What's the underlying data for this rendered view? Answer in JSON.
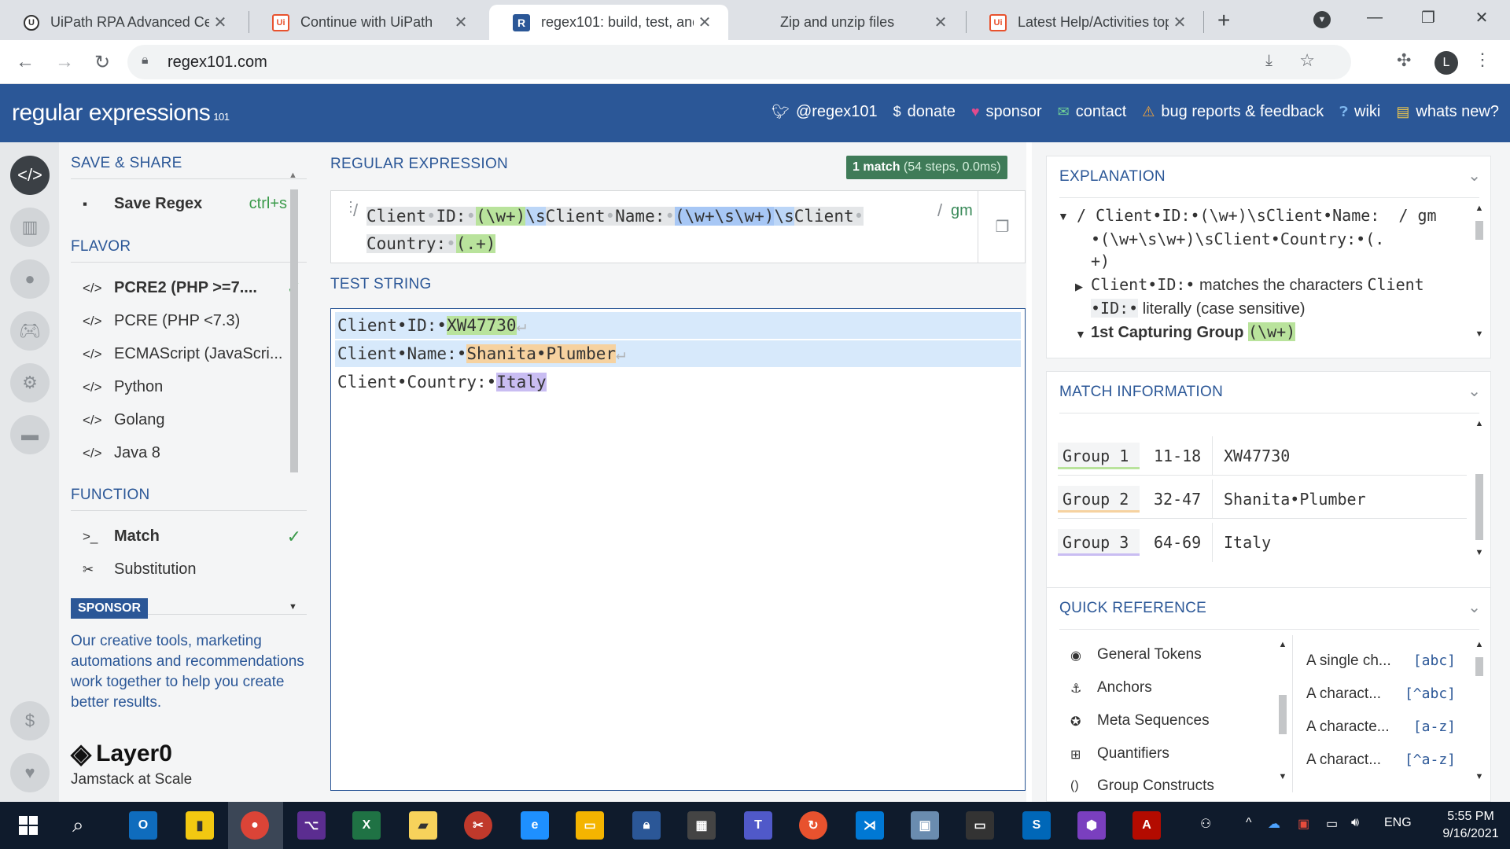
{
  "browser": {
    "tabs": [
      {
        "title": "UiPath RPA Advanced Cer",
        "favicon": "U",
        "active": false
      },
      {
        "title": "Continue with UiPath",
        "favicon": "Ui",
        "active": false
      },
      {
        "title": "regex101: build, test, and",
        "favicon": "R",
        "active": true
      },
      {
        "title": "Zip and unzip files",
        "favicon": "ms",
        "active": false
      },
      {
        "title": "Latest Help/Activities topi",
        "favicon": "Ui",
        "active": false
      }
    ],
    "url": "regex101.com",
    "profile_initial": "L"
  },
  "header": {
    "brand": "regular expressions",
    "brand_suffix": "101",
    "links": [
      {
        "icon": "twitter-icon",
        "label": "@regex101"
      },
      {
        "icon": "dollar-icon",
        "label": "donate"
      },
      {
        "icon": "heart-icon",
        "label": "sponsor"
      },
      {
        "icon": "mail-icon",
        "label": "contact"
      },
      {
        "icon": "warning-icon",
        "label": "bug reports & feedback"
      },
      {
        "icon": "book-icon",
        "label": "wiki"
      },
      {
        "icon": "news-icon",
        "label": "whats new?"
      }
    ]
  },
  "sidebar": {
    "save_share_title": "SAVE & SHARE",
    "save_regex_label": "Save Regex",
    "save_regex_shortcut": "ctrl+s",
    "flavor_title": "FLAVOR",
    "flavors": [
      {
        "label": "PCRE2 (PHP >=7....",
        "selected": true
      },
      {
        "label": "PCRE (PHP <7.3)",
        "selected": false
      },
      {
        "label": "ECMAScript (JavaScri...",
        "selected": false
      },
      {
        "label": "Python",
        "selected": false
      },
      {
        "label": "Golang",
        "selected": false
      },
      {
        "label": "Java 8",
        "selected": false
      }
    ],
    "function_title": "FUNCTION",
    "functions": [
      {
        "label": "Match",
        "selected": true
      },
      {
        "label": "Substitution",
        "selected": false
      }
    ],
    "sponsor_badge": "SPONSOR",
    "sponsor_text": "Our creative tools, marketing automations and recommendations work together to help you create better results.",
    "sponsor_logo": "Layer0",
    "sponsor_tagline": "Jamstack at Scale"
  },
  "regex": {
    "title": "REGULAR EXPRESSION",
    "match_count": "1 match",
    "match_stats": "(54 steps, 0.0ms)",
    "open_delim": "/",
    "close_delim": "/",
    "flags": "gm",
    "line1": [
      "Client",
      "•",
      "ID:",
      "•",
      "(\\w+)",
      "\\s",
      "Client",
      "•",
      "Name:",
      "•",
      "(\\w+\\s\\w+)",
      "\\s",
      "Client",
      "•"
    ],
    "line2": [
      "Country:",
      "•",
      "(.+)"
    ]
  },
  "test": {
    "title": "TEST STRING",
    "lines": [
      {
        "label": "Client•ID:•",
        "value": "XW47730"
      },
      {
        "label": "Client•Name:•",
        "value": "Shanita•Plumber"
      },
      {
        "label": "Client•Country:•",
        "value": "Italy"
      }
    ]
  },
  "explanation": {
    "title": "EXPLANATION",
    "line1": "/ Client•ID:•(\\w+)\\sClient•Name:  / gm",
    "line2": "•(\\w+\\s\\w+)\\sClient•Country:•(.",
    "line3": "+)",
    "item1_a": "Client•ID:•",
    "item1_b": "matches the characters",
    "item1_c": "Client",
    "item1_d": "•ID:•",
    "item1_e": "literally (case sensitive)",
    "item2_label": "1st Capturing Group",
    "item2_code": "(\\w+)"
  },
  "match_info": {
    "title": "MATCH INFORMATION",
    "rows": [
      {
        "group": "Group 1",
        "range": "11-18",
        "value": "XW47730"
      },
      {
        "group": "Group 2",
        "range": "32-47",
        "value": "Shanita•Plumber"
      },
      {
        "group": "Group 3",
        "range": "64-69",
        "value": "Italy"
      }
    ]
  },
  "quick_reference": {
    "title": "QUICK REFERENCE",
    "categories": [
      {
        "icon": "target-icon",
        "label": "General Tokens"
      },
      {
        "icon": "anchor-icon",
        "label": "Anchors"
      },
      {
        "icon": "meta-icon",
        "label": "Meta Sequences"
      },
      {
        "icon": "quantifier-icon",
        "label": "Quantifiers"
      },
      {
        "icon": "group-icon",
        "label": "Group Constructs"
      }
    ],
    "tokens": [
      {
        "desc": "A single ch...",
        "code": "[abc]"
      },
      {
        "desc": "A charact...",
        "code": "[^abc]"
      },
      {
        "desc": "A characte...",
        "code": "[a-z]"
      },
      {
        "desc": "A charact...",
        "code": "[^a-z]"
      }
    ]
  },
  "taskbar": {
    "lang": "ENG",
    "time": "5:55 PM",
    "date": "9/16/2021"
  }
}
